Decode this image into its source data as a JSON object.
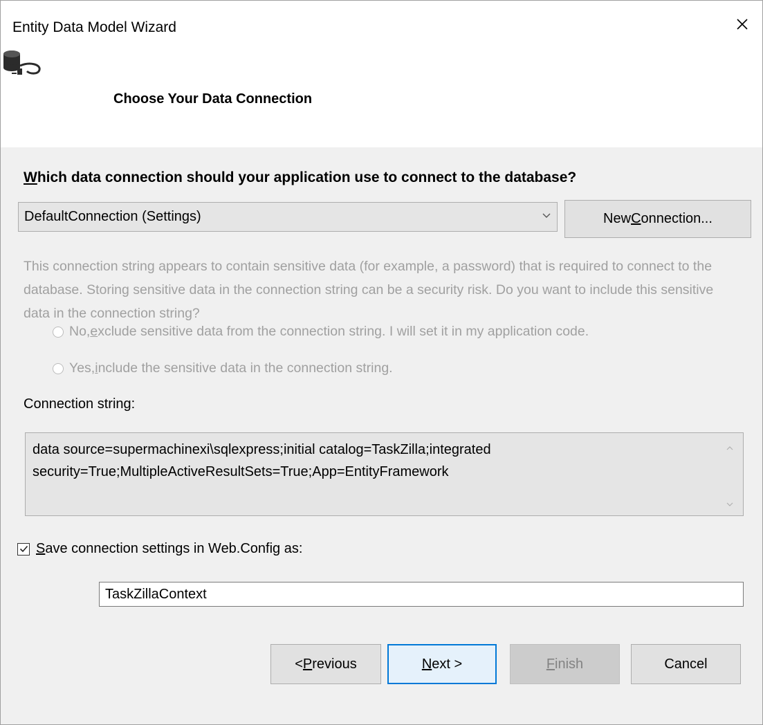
{
  "window": {
    "title": "Entity Data Model Wizard",
    "close_icon": "close-icon"
  },
  "header": {
    "heading": "Choose Your Data Connection",
    "icon": "database-connection-icon"
  },
  "question": {
    "mnemonic": "W",
    "rest": "hich data connection should your application use to connect to the database?"
  },
  "connection_select": {
    "value": "DefaultConnection (Settings)"
  },
  "new_connection_button": {
    "before": "New ",
    "mnemonic": "C",
    "after": "onnection..."
  },
  "sensitive_notice": "This connection string appears to contain sensitive data (for example, a password) that is required to connect to the database. Storing sensitive data in the connection string can be a security risk. Do you want to include this sensitive data in the connection string?",
  "options": [
    {
      "before": "No, ",
      "mnemonic": "e",
      "after": "xclude sensitive data from the connection string. I will set it in my application code."
    },
    {
      "before": "Yes, ",
      "mnemonic": "i",
      "after": "nclude the sensitive data in the connection string."
    }
  ],
  "connection_string": {
    "label": "Connection string:",
    "value": "data source=supermachinexi\\sqlexpress;initial catalog=TaskZilla;integrated security=True;MultipleActiveResultSets=True;App=EntityFramework"
  },
  "save_settings": {
    "checked": true,
    "mnemonic": "S",
    "rest": "ave connection settings in Web.Config as:",
    "value": "TaskZillaContext"
  },
  "footer": {
    "previous": {
      "before": "< ",
      "mnemonic": "P",
      "after": "revious"
    },
    "next": {
      "before": "",
      "mnemonic": "N",
      "after": "ext >"
    },
    "finish": {
      "before": "",
      "mnemonic": "F",
      "after": "inish"
    },
    "cancel": "Cancel"
  },
  "colors": {
    "accent": "#0078d7",
    "disabled_text": "#a0a0a0",
    "dialog_bg": "#f0f0f0"
  }
}
